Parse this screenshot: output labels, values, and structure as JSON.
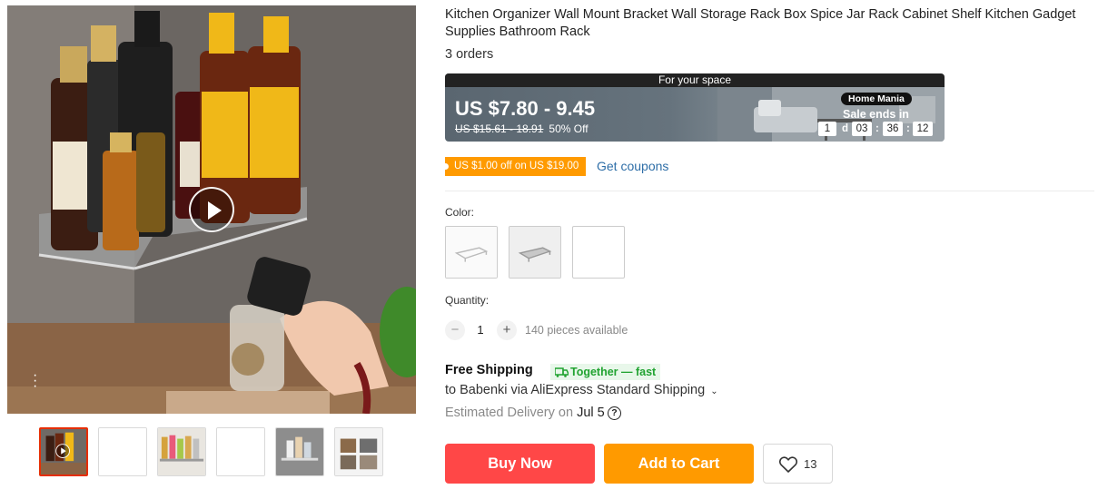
{
  "product": {
    "title": "Kitchen Organizer Wall Mount Bracket Wall Storage Rack Box Spice Jar Rack Cabinet Shelf Kitchen Gadget Supplies Bathroom Rack",
    "orders": "3 orders"
  },
  "gallery": {
    "main_image_icon": "spice-rack-photo",
    "play_icon": "play-icon",
    "thumbnails_count": 6,
    "active_thumbnail": 1
  },
  "price_banner": {
    "header": "For your space",
    "price": "US $7.80 - 9.45",
    "original_price": "US $15.61 - 18.91",
    "discount": "50% Off",
    "store_badge": "Home Mania",
    "sale_ends_label": "Sale ends in",
    "timer": {
      "days": "1",
      "days_unit": "d",
      "hours": "03",
      "minutes": "36",
      "seconds": "12"
    }
  },
  "coupon": {
    "tag": "US $1.00 off on US $19.00",
    "link": "Get coupons"
  },
  "color": {
    "label": "Color:",
    "options_count": 3
  },
  "quantity": {
    "label": "Quantity:",
    "minus": "−",
    "value": "1",
    "plus": "+",
    "available": "140 pieces available"
  },
  "shipping": {
    "title": "Free Shipping",
    "badge": "Together — fast",
    "to": "to Babenki via AliExpress Standard Shipping",
    "chevron": "⌄",
    "estimated_prefix": "Estimated Delivery on",
    "estimated_date": "Jul 5",
    "help": "?"
  },
  "actions": {
    "buy_now": "Buy Now",
    "add_to_cart": "Add to Cart",
    "wishlist_count": "13"
  },
  "colors": {
    "buy_now": "#ff4747",
    "add_to_cart": "#ff9a00",
    "coupon": "#ff9a00",
    "link": "#2e6ea7",
    "fast_badge": "#21a331"
  }
}
